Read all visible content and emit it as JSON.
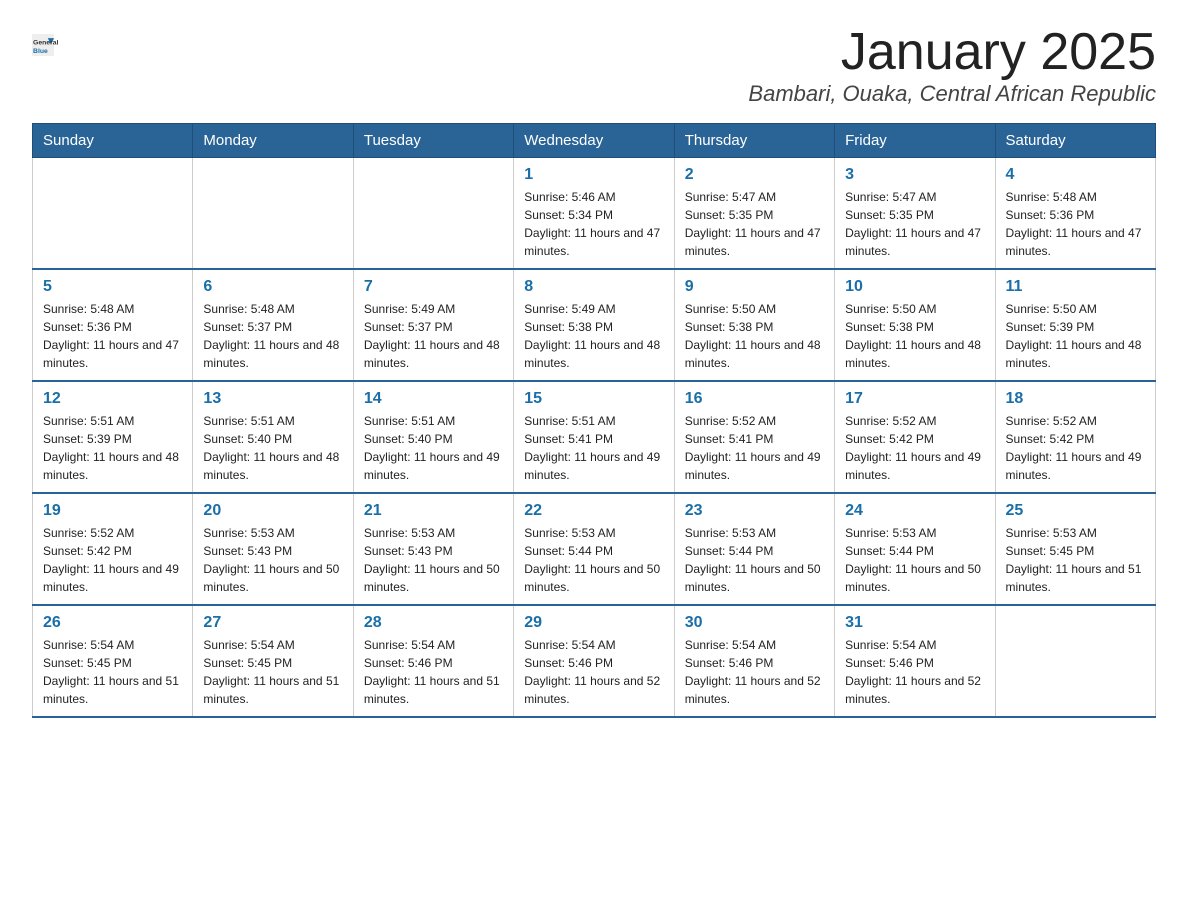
{
  "header": {
    "logo_text_general": "General",
    "logo_text_blue": "Blue",
    "month_title": "January 2025",
    "location": "Bambari, Ouaka, Central African Republic"
  },
  "days_of_week": [
    "Sunday",
    "Monday",
    "Tuesday",
    "Wednesday",
    "Thursday",
    "Friday",
    "Saturday"
  ],
  "weeks": [
    {
      "days": [
        {
          "num": "",
          "info": ""
        },
        {
          "num": "",
          "info": ""
        },
        {
          "num": "",
          "info": ""
        },
        {
          "num": "1",
          "info": "Sunrise: 5:46 AM\nSunset: 5:34 PM\nDaylight: 11 hours and 47 minutes."
        },
        {
          "num": "2",
          "info": "Sunrise: 5:47 AM\nSunset: 5:35 PM\nDaylight: 11 hours and 47 minutes."
        },
        {
          "num": "3",
          "info": "Sunrise: 5:47 AM\nSunset: 5:35 PM\nDaylight: 11 hours and 47 minutes."
        },
        {
          "num": "4",
          "info": "Sunrise: 5:48 AM\nSunset: 5:36 PM\nDaylight: 11 hours and 47 minutes."
        }
      ]
    },
    {
      "days": [
        {
          "num": "5",
          "info": "Sunrise: 5:48 AM\nSunset: 5:36 PM\nDaylight: 11 hours and 47 minutes."
        },
        {
          "num": "6",
          "info": "Sunrise: 5:48 AM\nSunset: 5:37 PM\nDaylight: 11 hours and 48 minutes."
        },
        {
          "num": "7",
          "info": "Sunrise: 5:49 AM\nSunset: 5:37 PM\nDaylight: 11 hours and 48 minutes."
        },
        {
          "num": "8",
          "info": "Sunrise: 5:49 AM\nSunset: 5:38 PM\nDaylight: 11 hours and 48 minutes."
        },
        {
          "num": "9",
          "info": "Sunrise: 5:50 AM\nSunset: 5:38 PM\nDaylight: 11 hours and 48 minutes."
        },
        {
          "num": "10",
          "info": "Sunrise: 5:50 AM\nSunset: 5:38 PM\nDaylight: 11 hours and 48 minutes."
        },
        {
          "num": "11",
          "info": "Sunrise: 5:50 AM\nSunset: 5:39 PM\nDaylight: 11 hours and 48 minutes."
        }
      ]
    },
    {
      "days": [
        {
          "num": "12",
          "info": "Sunrise: 5:51 AM\nSunset: 5:39 PM\nDaylight: 11 hours and 48 minutes."
        },
        {
          "num": "13",
          "info": "Sunrise: 5:51 AM\nSunset: 5:40 PM\nDaylight: 11 hours and 48 minutes."
        },
        {
          "num": "14",
          "info": "Sunrise: 5:51 AM\nSunset: 5:40 PM\nDaylight: 11 hours and 49 minutes."
        },
        {
          "num": "15",
          "info": "Sunrise: 5:51 AM\nSunset: 5:41 PM\nDaylight: 11 hours and 49 minutes."
        },
        {
          "num": "16",
          "info": "Sunrise: 5:52 AM\nSunset: 5:41 PM\nDaylight: 11 hours and 49 minutes."
        },
        {
          "num": "17",
          "info": "Sunrise: 5:52 AM\nSunset: 5:42 PM\nDaylight: 11 hours and 49 minutes."
        },
        {
          "num": "18",
          "info": "Sunrise: 5:52 AM\nSunset: 5:42 PM\nDaylight: 11 hours and 49 minutes."
        }
      ]
    },
    {
      "days": [
        {
          "num": "19",
          "info": "Sunrise: 5:52 AM\nSunset: 5:42 PM\nDaylight: 11 hours and 49 minutes."
        },
        {
          "num": "20",
          "info": "Sunrise: 5:53 AM\nSunset: 5:43 PM\nDaylight: 11 hours and 50 minutes."
        },
        {
          "num": "21",
          "info": "Sunrise: 5:53 AM\nSunset: 5:43 PM\nDaylight: 11 hours and 50 minutes."
        },
        {
          "num": "22",
          "info": "Sunrise: 5:53 AM\nSunset: 5:44 PM\nDaylight: 11 hours and 50 minutes."
        },
        {
          "num": "23",
          "info": "Sunrise: 5:53 AM\nSunset: 5:44 PM\nDaylight: 11 hours and 50 minutes."
        },
        {
          "num": "24",
          "info": "Sunrise: 5:53 AM\nSunset: 5:44 PM\nDaylight: 11 hours and 50 minutes."
        },
        {
          "num": "25",
          "info": "Sunrise: 5:53 AM\nSunset: 5:45 PM\nDaylight: 11 hours and 51 minutes."
        }
      ]
    },
    {
      "days": [
        {
          "num": "26",
          "info": "Sunrise: 5:54 AM\nSunset: 5:45 PM\nDaylight: 11 hours and 51 minutes."
        },
        {
          "num": "27",
          "info": "Sunrise: 5:54 AM\nSunset: 5:45 PM\nDaylight: 11 hours and 51 minutes."
        },
        {
          "num": "28",
          "info": "Sunrise: 5:54 AM\nSunset: 5:46 PM\nDaylight: 11 hours and 51 minutes."
        },
        {
          "num": "29",
          "info": "Sunrise: 5:54 AM\nSunset: 5:46 PM\nDaylight: 11 hours and 52 minutes."
        },
        {
          "num": "30",
          "info": "Sunrise: 5:54 AM\nSunset: 5:46 PM\nDaylight: 11 hours and 52 minutes."
        },
        {
          "num": "31",
          "info": "Sunrise: 5:54 AM\nSunset: 5:46 PM\nDaylight: 11 hours and 52 minutes."
        },
        {
          "num": "",
          "info": ""
        }
      ]
    }
  ]
}
